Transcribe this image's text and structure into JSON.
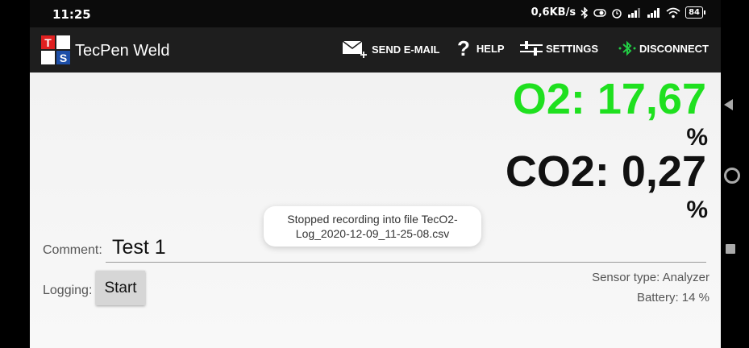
{
  "status": {
    "time": "11:25",
    "speed": "0,6KB/s",
    "battery": "84"
  },
  "appbar": {
    "title": "TecPen Weld",
    "logo_letters": [
      "T",
      "S"
    ],
    "actions": [
      {
        "label": "SEND E-MAIL",
        "icon": "email-plus-icon"
      },
      {
        "label": "HELP",
        "icon": "question-icon"
      },
      {
        "label": "SETTINGS",
        "icon": "sliders-icon"
      },
      {
        "label": "DISCONNECT",
        "icon": "bluetooth-icon"
      }
    ]
  },
  "readings": {
    "o2": "O2: 17,67",
    "o2_unit": "%",
    "co2": "CO2: 0,27",
    "co2_unit": "%"
  },
  "toast": {
    "message": "Stopped recording into file TecO2-Log_2020-12-09_11-25-08.csv"
  },
  "form": {
    "comment_label": "Comment:",
    "comment_value": "Test 1",
    "logging_label": "Logging:",
    "start_label": "Start"
  },
  "info": {
    "sensor_type": "Sensor type: Analyzer",
    "battery": "Battery: 14 %"
  },
  "colors": {
    "o2": "#1fe01f",
    "appbar": "#1e1e1e",
    "bluetooth": "#22cc44"
  }
}
